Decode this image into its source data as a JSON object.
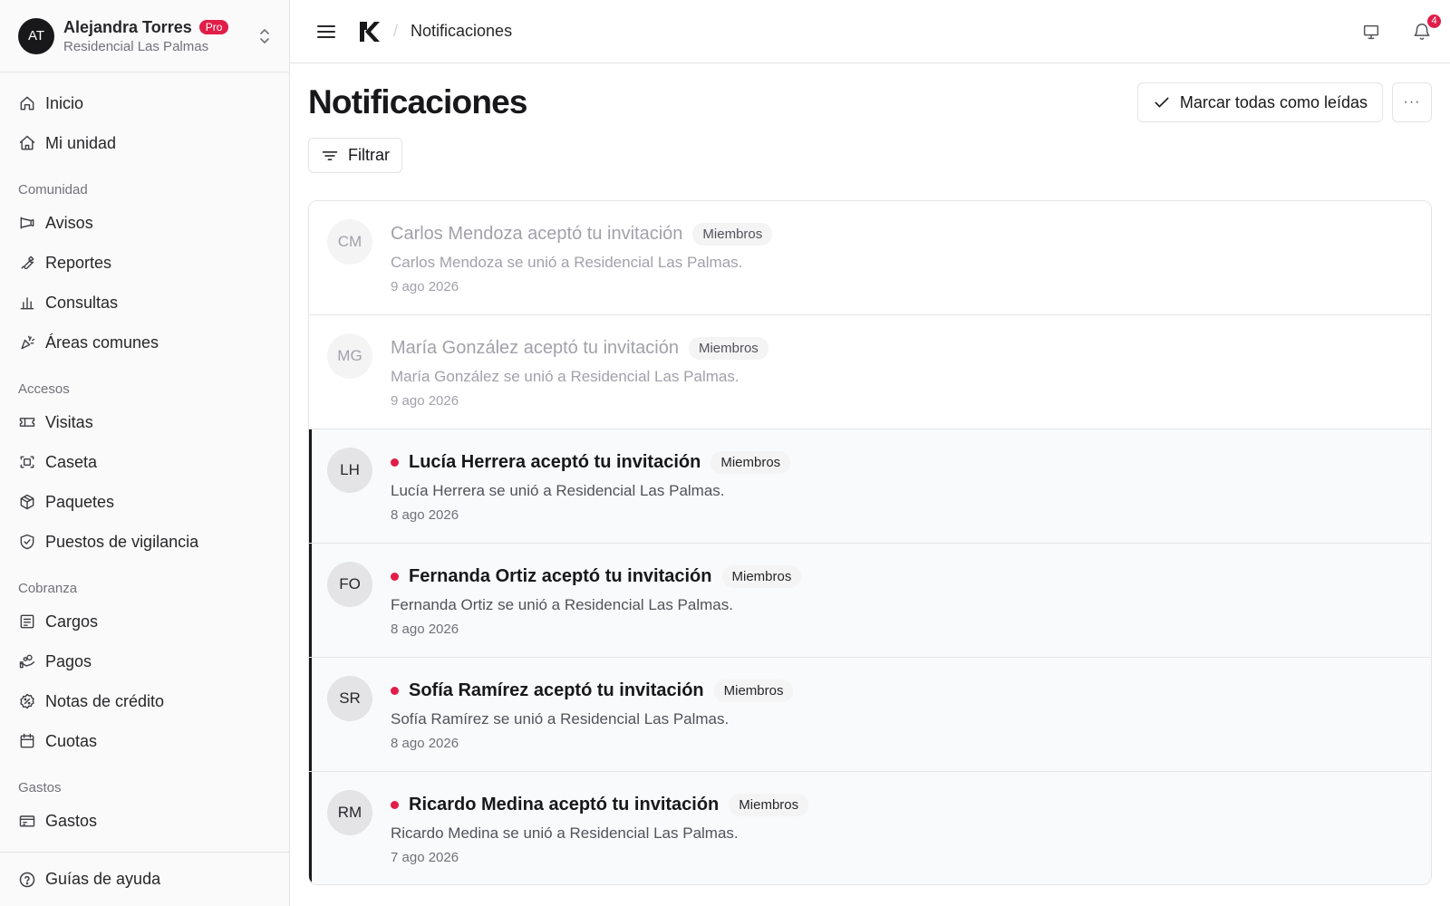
{
  "account": {
    "initials": "AT",
    "name": "Alejandra Torres",
    "plan_badge": "Pro",
    "community": "Residencial Las Palmas"
  },
  "nav": {
    "items_top": [
      {
        "label": "Inicio",
        "icon": "home-icon"
      },
      {
        "label": "Mi unidad",
        "icon": "house-icon"
      }
    ],
    "sections": [
      {
        "title": "Comunidad",
        "items": [
          {
            "label": "Avisos",
            "icon": "megaphone-icon"
          },
          {
            "label": "Reportes",
            "icon": "wrench-icon"
          },
          {
            "label": "Consultas",
            "icon": "bar-chart-icon"
          },
          {
            "label": "Áreas comunes",
            "icon": "party-popper-icon"
          }
        ]
      },
      {
        "title": "Accesos",
        "items": [
          {
            "label": "Visitas",
            "icon": "ticket-icon"
          },
          {
            "label": "Caseta",
            "icon": "scan-icon"
          },
          {
            "label": "Paquetes",
            "icon": "package-icon"
          },
          {
            "label": "Puestos de vigilancia",
            "icon": "shield-check-icon"
          }
        ]
      },
      {
        "title": "Cobranza",
        "items": [
          {
            "label": "Cargos",
            "icon": "receipt-icon"
          },
          {
            "label": "Pagos",
            "icon": "hand-coins-icon"
          },
          {
            "label": "Notas de crédito",
            "icon": "badge-percent-icon"
          },
          {
            "label": "Cuotas",
            "icon": "calendar-icon"
          }
        ]
      },
      {
        "title": "Gastos",
        "items": [
          {
            "label": "Gastos",
            "icon": "wallet-icon"
          }
        ]
      }
    ],
    "footer": {
      "label": "Guías de ayuda",
      "icon": "help-circle-icon"
    }
  },
  "topbar": {
    "breadcrumb": "Notificaciones",
    "notification_count": "4"
  },
  "page": {
    "title": "Notificaciones",
    "mark_all_label": "Marcar todas como leídas",
    "more_label": "···",
    "filter_label": "Filtrar"
  },
  "notifications": [
    {
      "initials": "CM",
      "title": "Carlos Mendoza aceptó tu invitación",
      "tag": "Miembros",
      "description": "Carlos Mendoza se unió a Residencial Las Palmas.",
      "date": "9 ago 2026",
      "unread": false
    },
    {
      "initials": "MG",
      "title": "María González aceptó tu invitación",
      "tag": "Miembros",
      "description": "María González se unió a Residencial Las Palmas.",
      "date": "9 ago 2026",
      "unread": false
    },
    {
      "initials": "LH",
      "title": "Lucía Herrera aceptó tu invitación",
      "tag": "Miembros",
      "description": "Lucía Herrera se unió a Residencial Las Palmas.",
      "date": "8 ago 2026",
      "unread": true
    },
    {
      "initials": "FO",
      "title": "Fernanda Ortiz aceptó tu invitación",
      "tag": "Miembros",
      "description": "Fernanda Ortiz se unió a Residencial Las Palmas.",
      "date": "8 ago 2026",
      "unread": true
    },
    {
      "initials": "SR",
      "title": "Sofía Ramírez aceptó tu invitación",
      "tag": "Miembros",
      "description": "Sofía Ramírez se unió a Residencial Las Palmas.",
      "date": "8 ago 2026",
      "unread": true
    },
    {
      "initials": "RM",
      "title": "Ricardo Medina aceptó tu invitación",
      "tag": "Miembros",
      "description": "Ricardo Medina se unió a Residencial Las Palmas.",
      "date": "7 ago 2026",
      "unread": true
    }
  ],
  "colors": {
    "accent": "#e11d48",
    "unread_bar": "#18181b",
    "sidebar_bg": "#fafafa"
  }
}
